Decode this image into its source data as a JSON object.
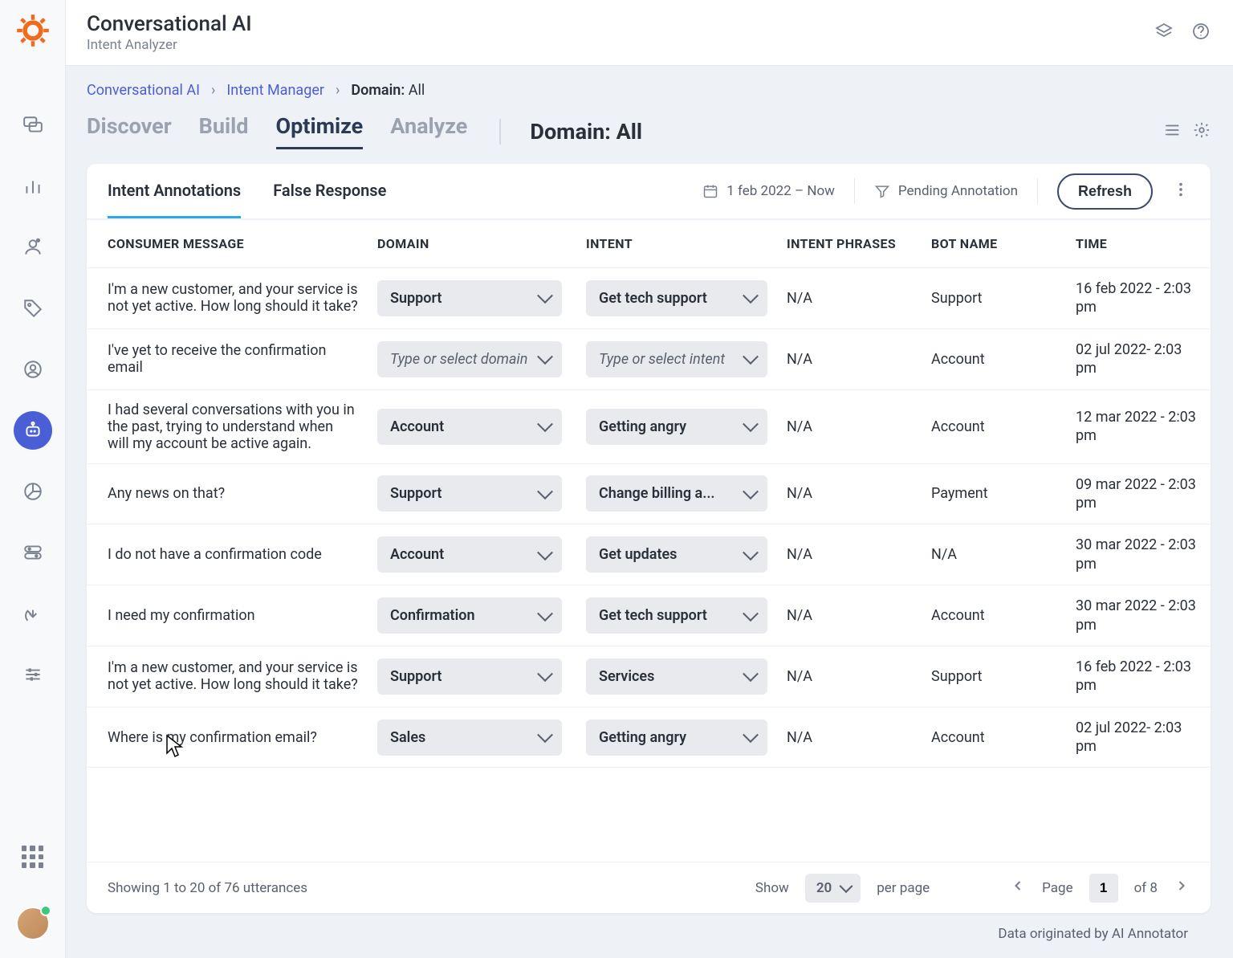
{
  "header": {
    "title": "Conversational AI",
    "subtitle": "Intent Analyzer"
  },
  "breadcrumb": {
    "items": [
      "Conversational AI",
      "Intent Manager"
    ],
    "current_label": "Domain:",
    "current_value": "All"
  },
  "tabs": {
    "items": [
      "Discover",
      "Build",
      "Optimize",
      "Analyze"
    ],
    "active": "Optimize"
  },
  "domain_heading": "Domain: All",
  "subtabs": {
    "items": [
      "Intent Annotations",
      "False Response"
    ],
    "active": "Intent Annotations"
  },
  "date_range": "1 feb 2022  –  Now",
  "filter_label": "Pending Annotation",
  "refresh_label": "Refresh",
  "columns": [
    "CONSUMER MESSAGE",
    "DOMAIN",
    "INTENT",
    "INTENT PHRASES",
    "BOT NAME",
    "TIME"
  ],
  "domain_placeholder": "Type or select domain",
  "intent_placeholder": "Type or select intent",
  "rows": [
    {
      "message": "I'm a new customer, and your service is not yet active. How long should it take?",
      "domain": "Support",
      "intent": "Get tech support",
      "phrases": "N/A",
      "bot": "Support",
      "time": "16 feb 2022 - 2:03 pm"
    },
    {
      "message": "I've yet to receive the confirmation email",
      "domain": "",
      "intent": "",
      "phrases": "N/A",
      "bot": "Account",
      "time": "02 jul 2022- 2:03 pm"
    },
    {
      "message": "I had several conversations with you in the past, trying to understand when will my account be active again.",
      "domain": "Account",
      "intent": "Getting angry",
      "phrases": "N/A",
      "bot": "Account",
      "time": "12 mar 2022 - 2:03 pm"
    },
    {
      "message": "Any news on that?",
      "domain": "Support",
      "intent": "Change billing a...",
      "phrases": "N/A",
      "bot": "Payment",
      "time": "09 mar 2022 - 2:03 pm"
    },
    {
      "message": "I do not have a confirmation code",
      "domain": "Account",
      "intent": "Get updates",
      "phrases": "N/A",
      "bot": "N/A",
      "time": "30 mar 2022 - 2:03 pm"
    },
    {
      "message": "I need my confirmation",
      "domain": "Confirmation",
      "intent": "Get tech support",
      "phrases": "N/A",
      "bot": "Account",
      "time": "30 mar 2022 - 2:03 pm"
    },
    {
      "message": "I'm a new customer, and your service is not yet active. How long should it take?",
      "domain": "Support",
      "intent": "Services",
      "phrases": "N/A",
      "bot": "Support",
      "time": "16 feb 2022 - 2:03 pm"
    },
    {
      "message": "Where is my confirmation email?",
      "domain": "Sales",
      "intent": "Getting angry",
      "phrases": "N/A",
      "bot": "Account",
      "time": "02 jul 2022- 2:03 pm"
    }
  ],
  "footer": {
    "showing": "Showing 1 to 20 of 76 utterances",
    "show_label": "Show",
    "page_size": "20",
    "per_page": "per page",
    "page_label": "Page",
    "page_current": "1",
    "of_label": "of 8"
  },
  "origin": "Data originated by AI Annotator"
}
